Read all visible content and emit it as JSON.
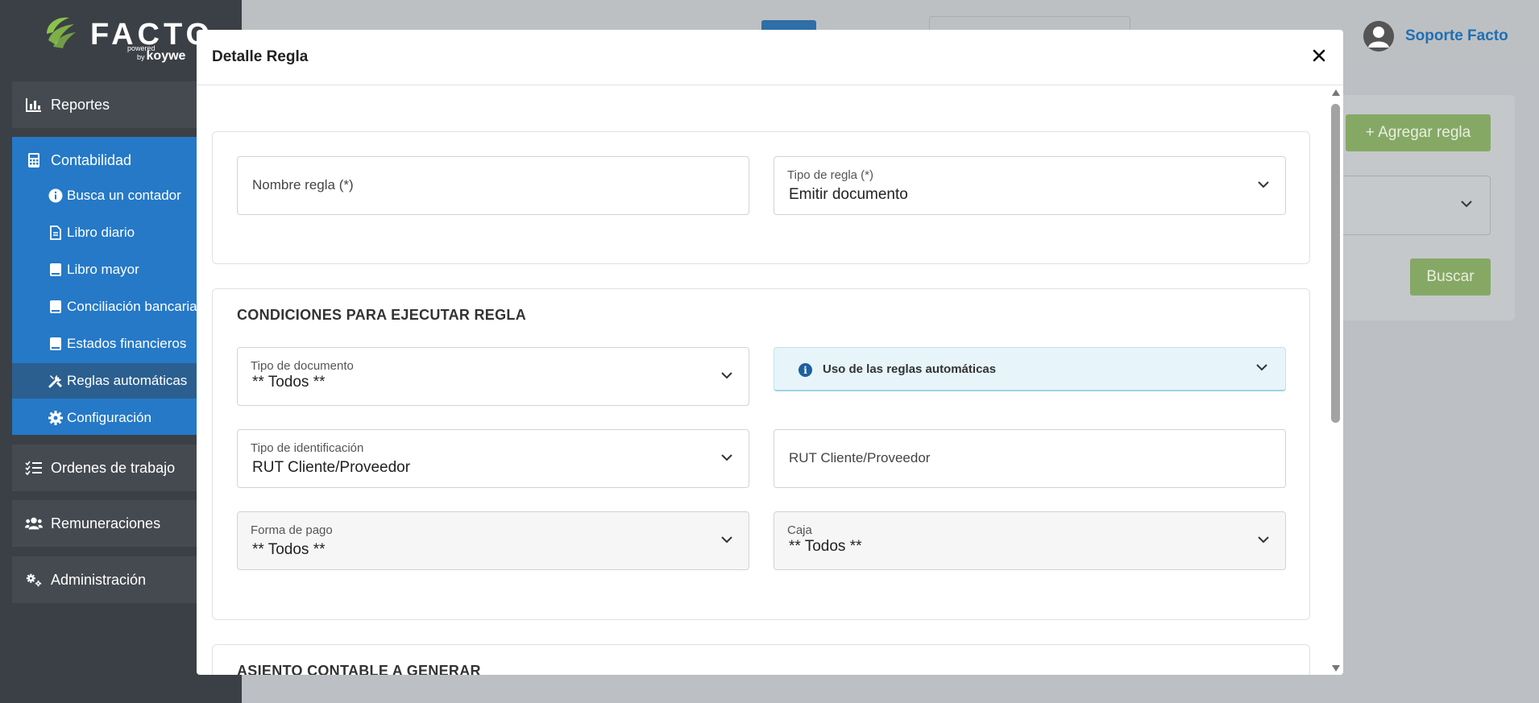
{
  "sidebar": {
    "logo": {
      "text": "FACTO",
      "powered": "powered",
      "by": "by",
      "brand": "koywe"
    },
    "items": {
      "reportes": "Reportes",
      "contabilidad": "Contabilidad",
      "ordenes": "Ordenes de trabajo",
      "remuneraciones": "Remuneraciones",
      "administracion": "Administración"
    },
    "contabilidad_sub": [
      {
        "label": "Busca un contador",
        "icon": "info-circle-icon"
      },
      {
        "label": "Libro diario",
        "icon": "file-icon"
      },
      {
        "label": "Libro mayor",
        "icon": "book-icon"
      },
      {
        "label": "Conciliación bancaria",
        "icon": "book-icon"
      },
      {
        "label": "Estados financieros",
        "icon": "book-icon"
      },
      {
        "label": "Reglas automáticas",
        "icon": "tools-icon",
        "active": true
      },
      {
        "label": "Configuración",
        "icon": "gear-icon"
      }
    ],
    "colors": {
      "bg": "#3b4046",
      "active_block": "#2579c7",
      "active_item": "#2b5f8f"
    }
  },
  "header": {
    "user_name": "Soporte Facto"
  },
  "background": {
    "add_rule_button": "+ Agregar regla",
    "search_button": "Buscar"
  },
  "modal": {
    "title": "Detalle Regla",
    "close_symbol": "×",
    "section1": {
      "rule_name_placeholder": "Nombre regla (*)",
      "rule_type_label": "Tipo de regla (*)",
      "rule_type_value": "Emitir documento"
    },
    "section2": {
      "title": "CONDICIONES PARA EJECUTAR REGLA",
      "doc_type_label": "Tipo de documento",
      "doc_type_value": "** Todos **",
      "info_title": "Uso de las reglas automáticas",
      "id_type_label": "Tipo de identificación",
      "id_type_value": "RUT Cliente/Proveedor",
      "rut_placeholder": "RUT Cliente/Proveedor",
      "payment_label": "Forma de pago",
      "payment_value": "** Todos **",
      "box_label": "Caja",
      "box_value": "** Todos **"
    },
    "section3": {
      "title": "ASIENTO CONTABLE A GENERAR"
    }
  }
}
